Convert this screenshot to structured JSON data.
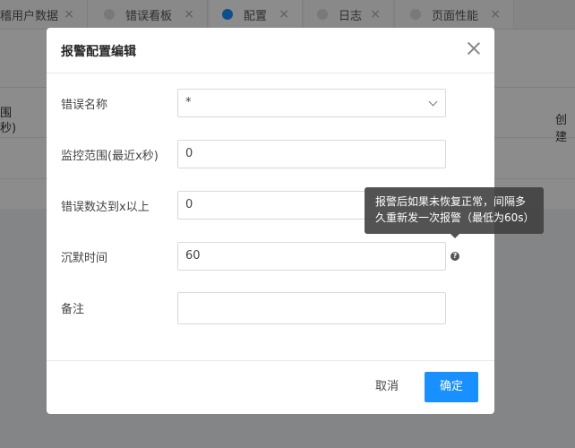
{
  "tabs": [
    {
      "label": "稽用户数据",
      "active": false
    },
    {
      "label": "错误看板",
      "active": false
    },
    {
      "label": "配置",
      "active": true
    },
    {
      "label": "日志",
      "active": false
    },
    {
      "label": "页面性能",
      "active": false
    }
  ],
  "background": {
    "col1_line1": "围",
    "col1_line2": "秒)",
    "col_right": "创建"
  },
  "modal": {
    "title": "报警配置编辑",
    "fields": {
      "error_name": {
        "label": "错误名称",
        "value": "*"
      },
      "range": {
        "label": "监控范围(最近x秒)",
        "value": "0"
      },
      "threshold": {
        "label": "错误数达到x以上",
        "value": "0"
      },
      "silence": {
        "label": "沉默时间",
        "value": "60"
      },
      "note": {
        "label": "备注",
        "value": ""
      }
    },
    "tooltip_line1": "报警后如果未恢复正常，间隔多",
    "tooltip_line2": "久重新发一次报警（最低为60s）",
    "cancel_label": "取消",
    "ok_label": "确定"
  },
  "colors": {
    "primary": "#1890ff",
    "overlay": "rgba(0,0,0,0.45)"
  }
}
